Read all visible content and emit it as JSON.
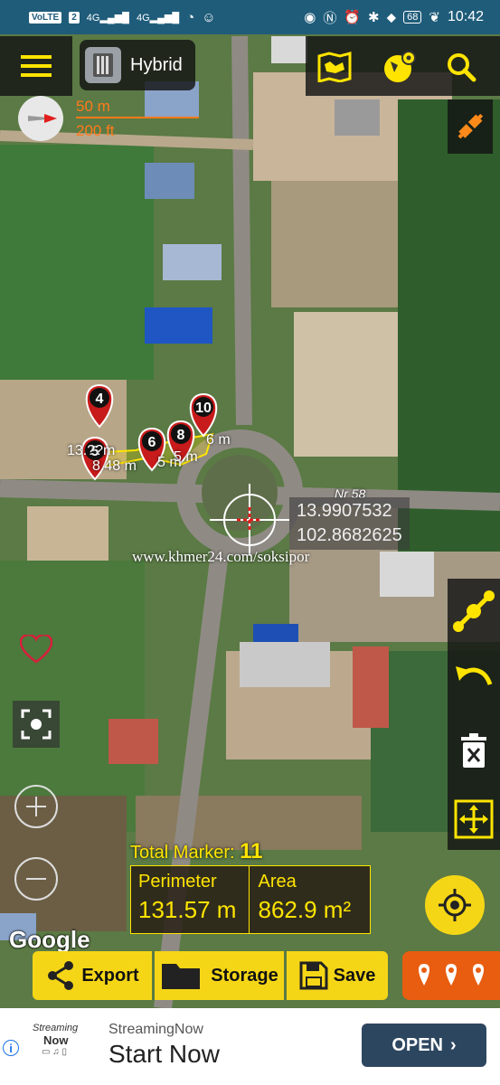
{
  "status_bar": {
    "network_chip": "VoLTE",
    "sim_slot": "2",
    "signal_1": "4G",
    "signal_2": "4G",
    "battery": "68",
    "time": "10:42"
  },
  "toolbar": {
    "map_type": "Hybrid"
  },
  "scale": {
    "metric": "50 m",
    "imperial": "200 ft"
  },
  "markers": {
    "labels": [
      "4",
      "5",
      "6",
      "8",
      "10"
    ],
    "segment_labels": [
      "13.??m",
      "8.48 m",
      "5 m",
      "6 m",
      "5 m"
    ]
  },
  "road_label": "Nr 58",
  "crosshair": {
    "lat": "13.9907532",
    "lon": "102.8682625"
  },
  "watermark": "www.khmer24.com/soksipor",
  "stats": {
    "total_marker_label": "Total Marker:",
    "total_marker_value": "11",
    "perimeter_label": "Perimeter",
    "perimeter_value": "131.57 m",
    "area_label": "Area",
    "area_value": "862.9 m²"
  },
  "google_logo": "Google",
  "actions": {
    "export": "Export",
    "storage": "Storage",
    "save": "Save"
  },
  "ad": {
    "brand_line1": "Streaming",
    "brand_line2": "Now",
    "title": "StreamingNow",
    "headline": "Start Now",
    "cta": "OPEN"
  },
  "colors": {
    "accent_yellow": "#ffe400",
    "status_bar": "#1f5c7a",
    "marker_red": "#d81e1e",
    "open_button": "#2d4660"
  }
}
